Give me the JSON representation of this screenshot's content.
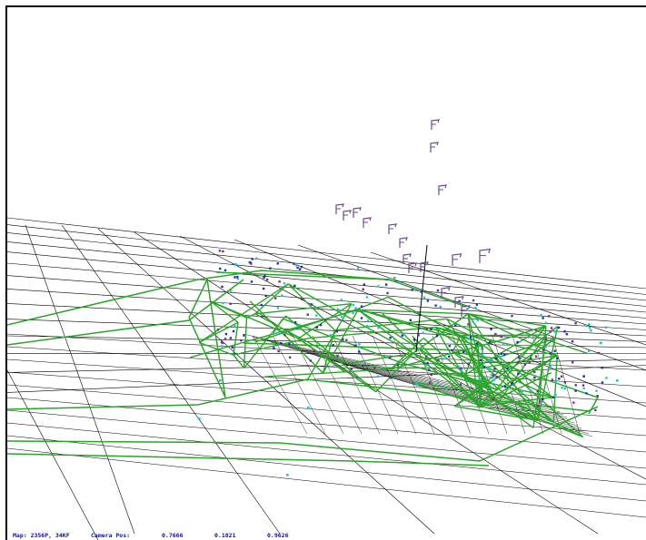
{
  "viewer": {
    "colors": {
      "background": "#ffffff",
      "frame": "#000000",
      "grid": "#000000",
      "graph": "#2aa52a",
      "point_cyan": "#22c0d0",
      "point_blue": "#2a2ab0",
      "point_purple": "#7a2a8a",
      "keyframe": "#6a4a8a",
      "status_text": "#1010b0"
    },
    "status": {
      "map_info": "Map: 2356P, 34KF",
      "camera_label": "Camera Pos:",
      "camera_x": "0.7666",
      "camera_y": "0.1821",
      "camera_z": "0.9626"
    }
  }
}
